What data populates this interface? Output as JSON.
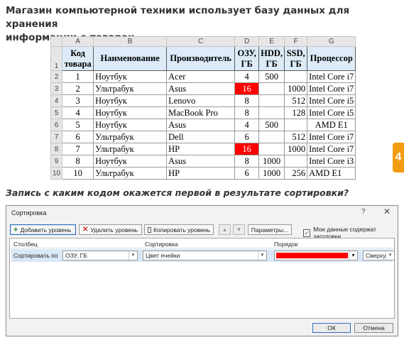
{
  "question": {
    "line1": "Магазин компьютерной техники использует базу данных для хранения",
    "line2": "информации о товарах.",
    "prompt": "Запись с каким кодом окажется первой в результате сортировки?"
  },
  "side_tab": {
    "label": "4",
    "color": "#f39c12"
  },
  "sheet": {
    "columns": [
      "A",
      "B",
      "C",
      "D",
      "E",
      "F",
      "G"
    ],
    "headers": {
      "code_l1": "Код",
      "code_l2": "товара",
      "name": "Наименование",
      "maker": "Производитель",
      "ram_l1": "ОЗУ,",
      "ram_l2": "ГБ",
      "hdd_l1": "HDD,",
      "hdd_l2": "ГБ",
      "ssd_l1": "SSD,",
      "ssd_l2": "ГБ",
      "cpu": "Процессор"
    },
    "rows": [
      {
        "num": "2",
        "code": "1",
        "name": "Ноутбук",
        "maker": "Acer",
        "ram": "4",
        "hdd": "500",
        "ssd": "",
        "cpu": "Intel Core i7"
      },
      {
        "num": "3",
        "code": "2",
        "name": "Ультрабук",
        "maker": "Asus",
        "ram": "16",
        "hdd": "",
        "ssd": "1000",
        "cpu": "Intel Core i7"
      },
      {
        "num": "4",
        "code": "3",
        "name": "Ноутбук",
        "maker": "Lenovo",
        "ram": "8",
        "hdd": "",
        "ssd": "512",
        "cpu": "Intel Core i5"
      },
      {
        "num": "5",
        "code": "4",
        "name": "Ноутбук",
        "maker": "MacBook Pro",
        "ram": "8",
        "hdd": "",
        "ssd": "128",
        "cpu": "Intel Core i5"
      },
      {
        "num": "6",
        "code": "5",
        "name": "Ноутбук",
        "maker": "Asus",
        "ram": "4",
        "hdd": "500",
        "ssd": "",
        "cpu": "AMD E1"
      },
      {
        "num": "7",
        "code": "6",
        "name": "Ультрабук",
        "maker": "Dell",
        "ram": "6",
        "hdd": "",
        "ssd": "512",
        "cpu": "Intel Core i7"
      },
      {
        "num": "8",
        "code": "7",
        "name": "Ультрабук",
        "maker": "HP",
        "ram": "16",
        "hdd": "",
        "ssd": "1000",
        "cpu": "Intel Core i7"
      },
      {
        "num": "9",
        "code": "8",
        "name": "Ноутбук",
        "maker": "Asus",
        "ram": "8",
        "hdd": "1000",
        "ssd": "",
        "cpu": "Intel Core i3"
      },
      {
        "num": "10",
        "code": "10",
        "name": "Ультрабук",
        "maker": "HP",
        "ram": "6",
        "hdd": "1000",
        "ssd": "256",
        "cpu": "AMD E1"
      }
    ],
    "highlight_color": "#ff0000"
  },
  "dialog": {
    "title": "Сортировка",
    "help": "?",
    "close": "✕",
    "toolbar": {
      "add": "Добавить уровень",
      "delete": "Удалить уровень",
      "copy": "Копировать уровень",
      "params": "Параметры...",
      "headers_checkbox": "Мои данные содержат заголовки",
      "headers_checked": true
    },
    "columns": {
      "column": "Столбец",
      "sort": "Сортировка",
      "order": "Порядок"
    },
    "level": {
      "label": "Сортировать по",
      "column_value": "ОЗУ, ГБ",
      "sort_on_value": "Цвет ячейки",
      "order_color": "#ff0000",
      "position_value": "Сверху"
    },
    "buttons": {
      "ok": "ОК",
      "cancel": "Отмена"
    }
  }
}
